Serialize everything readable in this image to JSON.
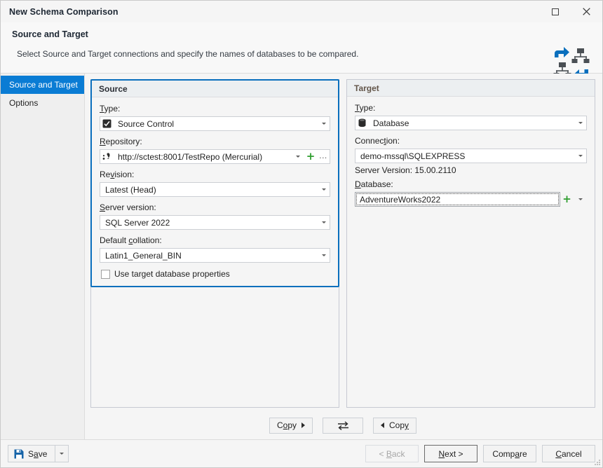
{
  "window": {
    "title": "New Schema Comparison",
    "maximize_label": "maximize",
    "close_label": "close"
  },
  "header": {
    "title": "Source and Target",
    "subtitle": "Select Source and Target connections and specify the names of databases to be compared."
  },
  "sidebar": {
    "items": [
      {
        "label": "Source and Target",
        "active": true
      },
      {
        "label": "Options",
        "active": false
      }
    ]
  },
  "source": {
    "group_title": "Source",
    "type_label": "Type:",
    "type_value": "Source Control",
    "type_icon": "source-control-icon",
    "repository_label": "Repository:",
    "repository_value": "http://sctest:8001/TestRepo (Mercurial)",
    "repository_icon": "mercurial-icon",
    "repository_add_label": "+",
    "repository_more_label": "...",
    "revision_label": "Revision:",
    "revision_value": "Latest (Head)",
    "server_version_label": "Server version:",
    "server_version_value": "SQL Server 2022",
    "collation_label": "Default collation:",
    "collation_value": "Latin1_General_BIN",
    "use_target_props_label": "Use target database properties",
    "use_target_props_checked": false
  },
  "target": {
    "group_title": "Target",
    "type_label": "Type:",
    "type_value": "Database",
    "type_icon": "database-icon",
    "connection_label": "Connection:",
    "connection_value": "demo-mssql\\SQLEXPRESS",
    "server_version_text": "Server Version: 15.00.2110",
    "database_label": "Database:",
    "database_value": "AdventureWorks2022",
    "database_add_label": "+"
  },
  "copy_bar": {
    "copy_to_target_label": "Copy",
    "swap_label": "swap",
    "copy_to_source_label": "Copy"
  },
  "footer": {
    "save_label": "Save",
    "save_icon": "floppy-disk-icon",
    "back_label": "< Back",
    "back_disabled": true,
    "next_label": "Next >",
    "next_default": true,
    "compare_label": "Compare",
    "cancel_label": "Cancel"
  },
  "colors": {
    "accent": "#0a7cd4",
    "group_border": "#0a6fbd",
    "plus_green": "#2f9e2f",
    "logo_blue": "#0a6fbd",
    "logo_gray": "#4a4f54"
  }
}
